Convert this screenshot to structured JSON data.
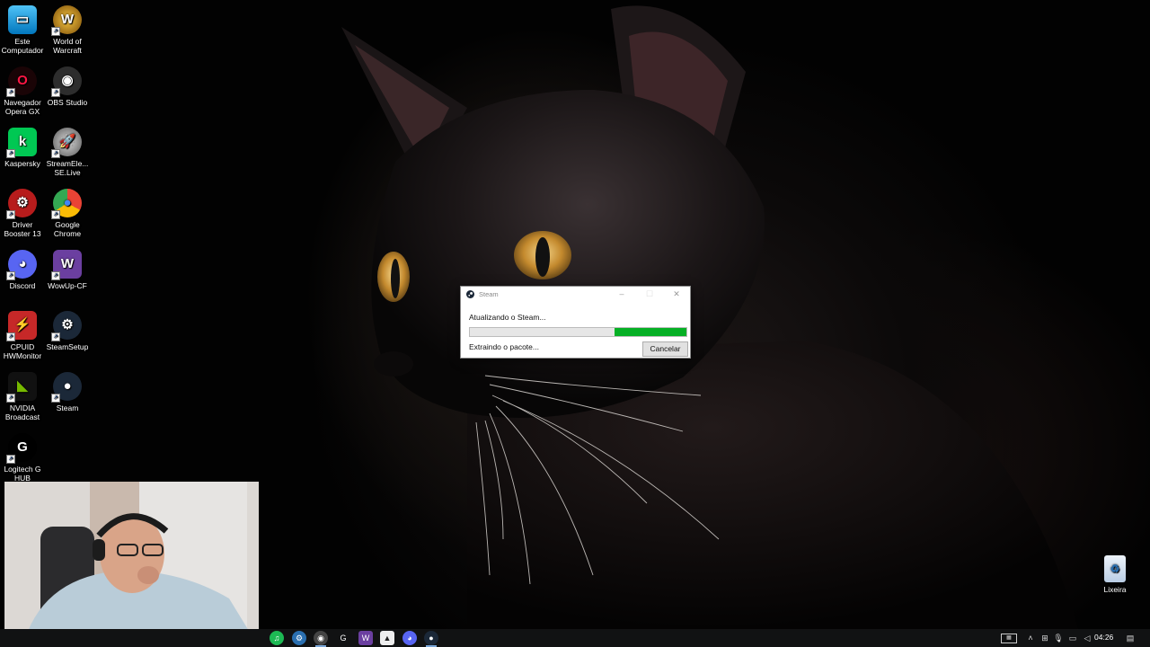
{
  "desktop": {
    "icons": [
      {
        "label": "Este Computador",
        "icon": "monitor-icon"
      },
      {
        "label": "World of Warcraft",
        "icon": "wow-icon"
      },
      {
        "label": "Navegador Opera GX",
        "icon": "opera-gx-icon"
      },
      {
        "label": "OBS Studio",
        "icon": "obs-icon"
      },
      {
        "label": "Kaspersky",
        "icon": "kaspersky-icon"
      },
      {
        "label": "StreamEle... SE.Live",
        "icon": "streamelements-icon"
      },
      {
        "label": "Driver Booster 13",
        "icon": "driver-booster-icon"
      },
      {
        "label": "Google Chrome",
        "icon": "chrome-icon"
      },
      {
        "label": "Discord",
        "icon": "discord-icon"
      },
      {
        "label": "WowUp-CF",
        "icon": "wowup-icon"
      },
      {
        "label": "CPUID HWMonitor",
        "icon": "hwmonitor-icon"
      },
      {
        "label": "SteamSetup",
        "icon": "steam-setup-icon"
      },
      {
        "label": "NVIDIA Broadcast",
        "icon": "nvidia-broadcast-icon"
      },
      {
        "label": "Steam",
        "icon": "steam-icon"
      },
      {
        "label": "Logitech G HUB",
        "icon": "logitech-icon"
      },
      {
        "label": "Lixeira",
        "icon": "recycle-bin-icon"
      }
    ]
  },
  "steam_dialog": {
    "title": "Steam",
    "status": "Atualizando o Steam...",
    "progress_fraction": 0.33,
    "detail": "Extraindo o pacote...",
    "cancel_label": "Cancelar",
    "accent": "#06b025"
  },
  "taskbar": {
    "apps": [
      "spotify-icon",
      "steam-setup-icon",
      "obs-icon",
      "logitech-icon",
      "wowup-icon",
      "photos-icon",
      "discord-icon",
      "steam-icon"
    ],
    "clock": "04:26"
  }
}
